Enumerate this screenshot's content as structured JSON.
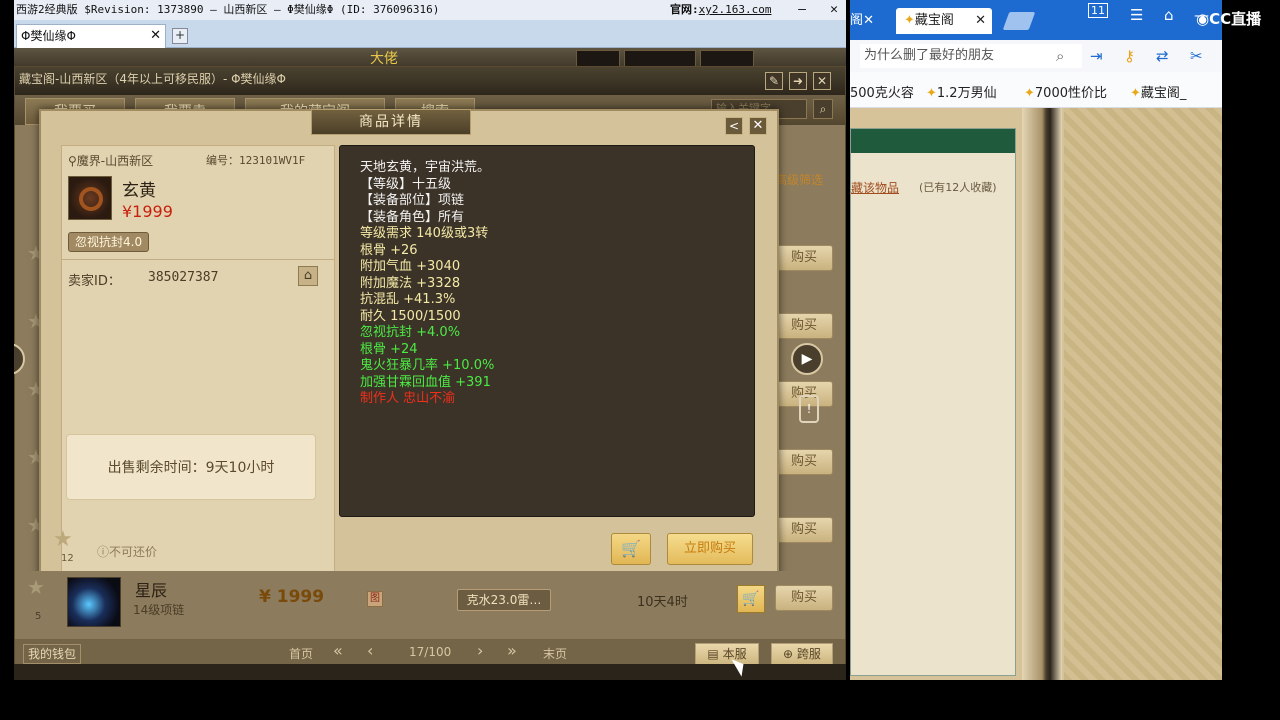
{
  "game": {
    "title": "西游2经典版 $Revision: 1373890 — 山西新区 — Φ樊仙缘Φ (ID: 376096316)",
    "site_label": "官网:",
    "site_url": "xy2.163.com",
    "tab_label": "Φ樊仙缘Φ",
    "boss_label": "大佬"
  },
  "cbg": {
    "header": "藏宝阁-山西新区（4年以上可移民服）- Φ樊仙缘Φ",
    "tabs": [
      "我要买",
      "我要卖",
      "我的藏宝阁",
      "搜索"
    ],
    "search_placeholder": "输入关键字",
    "advanced_filter": "高级筛选",
    "buy_label": "购买"
  },
  "detail": {
    "title": "商品详情",
    "location": "魔界-山西新区",
    "serial": "编号：123101WV1F",
    "item_name": "玄黄",
    "item_price": "¥1999",
    "item_tag": "忽视抗封4.0",
    "seller_label": "卖家ID：",
    "seller_id": "385027387",
    "remaining_time": "出售剩余时间：9天10小时",
    "not_returnable": "不可还价",
    "buy_now": "立即购买",
    "attributes": [
      {
        "text": "天地玄黄，宇宙洪荒。",
        "color": "w"
      },
      {
        "text": "【等级】十五级",
        "color": "w"
      },
      {
        "text": "【装备部位】项链",
        "color": "w"
      },
      {
        "text": "【装备角色】所有",
        "color": "w"
      },
      {
        "text": "等级需求 140级或3转",
        "color": "y"
      },
      {
        "text": "根骨 +26",
        "color": "y"
      },
      {
        "text": "附加气血 +3040",
        "color": "y"
      },
      {
        "text": "附加魔法 +3328",
        "color": "y"
      },
      {
        "text": "抗混乱 +41.3%",
        "color": "y"
      },
      {
        "text": "耐久 1500/1500",
        "color": "y"
      },
      {
        "text": "忽视抗封 +4.0%",
        "color": "g"
      },
      {
        "text": "根骨 +24",
        "color": "g"
      },
      {
        "text": "鬼火狂暴几率 +10.0%",
        "color": "g"
      },
      {
        "text": "加强甘霖回血值 +391",
        "color": "g"
      },
      {
        "text": "制作人 忠山不渝",
        "color": "r"
      }
    ]
  },
  "row2": {
    "name": "星辰",
    "sub": "14级项链",
    "price": "¥ 1999",
    "tag": "克水23.0雷…",
    "time": "10天4时",
    "star_count": "5",
    "mark": "图"
  },
  "list_star_count": "12",
  "pager": {
    "wallet": "我的钱包",
    "first": "首页",
    "page": "17/100",
    "last": "末页",
    "this_server": "本服",
    "cross_server": "跨服"
  },
  "browser": {
    "tab0_label": "阁",
    "tab1_label": "藏宝阁",
    "search_text": "为什么删了最好的朋友",
    "bookmarks": [
      "500克火容",
      "1.2万男仙",
      "7000性价比",
      "藏宝阁_"
    ],
    "fav_link": "藏该物品",
    "fav_count": "(已有12人收藏)",
    "badge": "11"
  },
  "watermark": "CC直播"
}
